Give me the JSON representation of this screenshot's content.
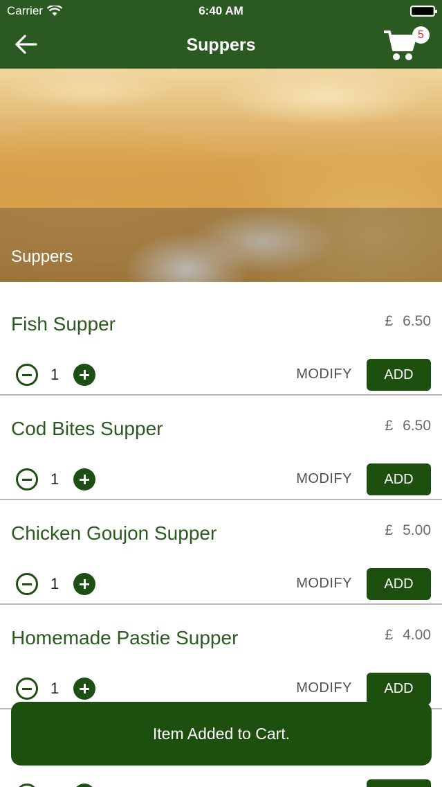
{
  "status_bar": {
    "carrier": "Carrier",
    "time": "6:40 AM"
  },
  "nav": {
    "title": "Suppers",
    "cart_count": "5"
  },
  "hero": {
    "caption": "Suppers"
  },
  "items": [
    {
      "name": "Fish Supper",
      "currency": "£",
      "price": "6.50",
      "qty": "1",
      "modify_label": "MODIFY",
      "add_label": "ADD"
    },
    {
      "name": "Cod Bites Supper",
      "currency": "£",
      "price": "6.50",
      "qty": "1",
      "modify_label": "MODIFY",
      "add_label": "ADD"
    },
    {
      "name": "Chicken Goujon Supper",
      "currency": "£",
      "price": "5.00",
      "qty": "1",
      "modify_label": "MODIFY",
      "add_label": "ADD"
    },
    {
      "name": "Homemade Pastie Supper",
      "currency": "£",
      "price": "4.00",
      "qty": "1",
      "modify_label": "MODIFY",
      "add_label": "ADD"
    }
  ],
  "toast": {
    "message": "Item Added to Cart."
  },
  "colors": {
    "header_green": "#2a5a21",
    "button_green": "#1d4f0f",
    "badge_red": "#d71f1f"
  }
}
